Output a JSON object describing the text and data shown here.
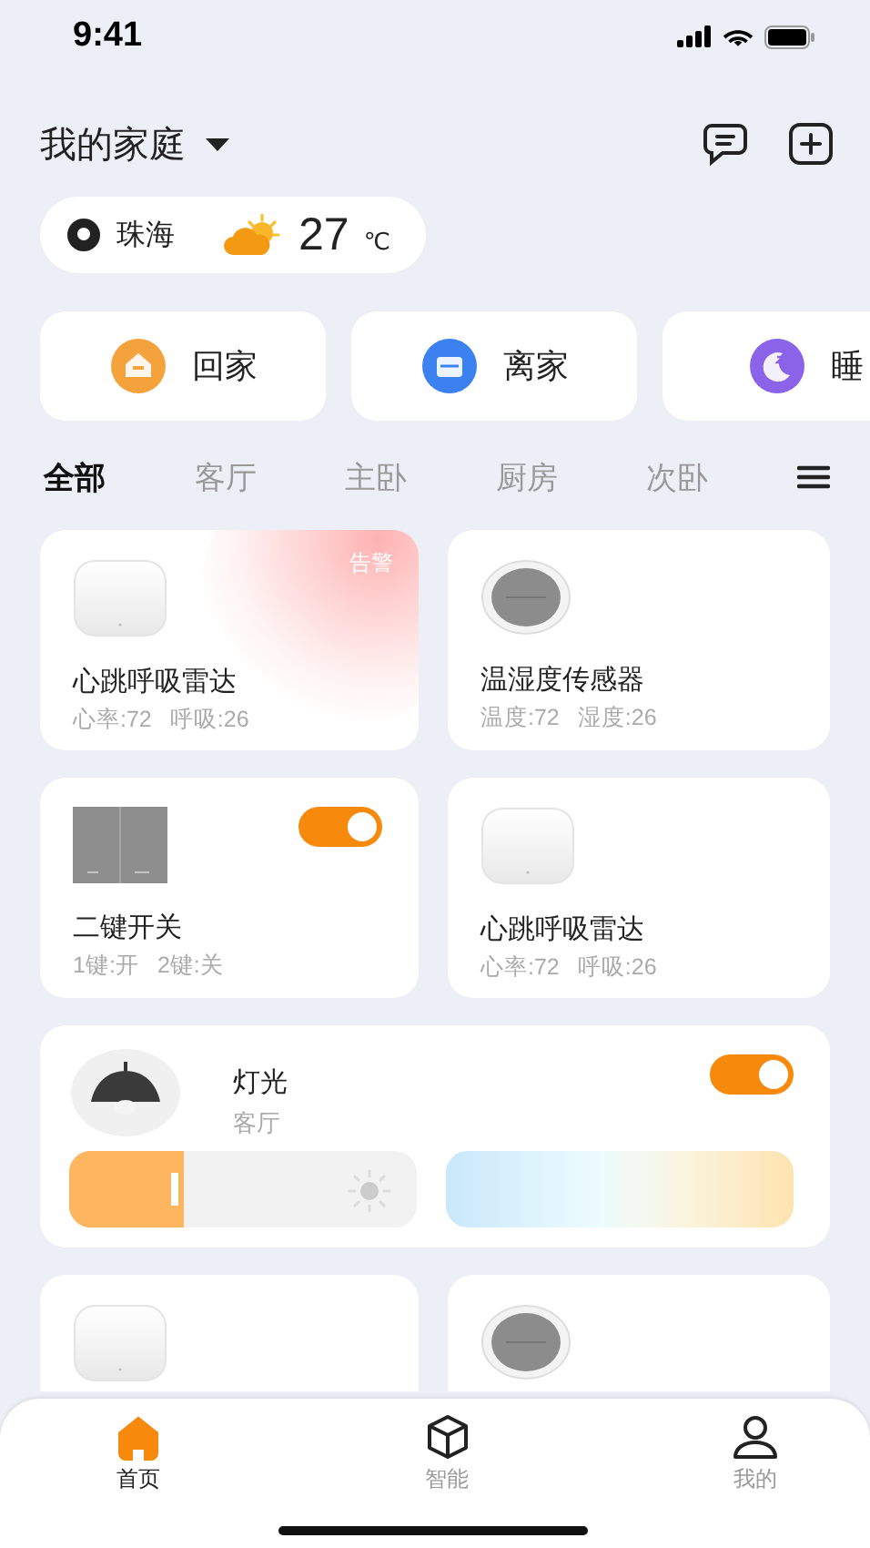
{
  "status_bar": {
    "time": "9:41"
  },
  "header": {
    "home": "我的家庭"
  },
  "weather": {
    "city": "珠海",
    "temperature": "27",
    "unit": "℃"
  },
  "scenes": [
    {
      "kind": "home",
      "label": "回家",
      "color": "#f4a23c"
    },
    {
      "kind": "away",
      "label": "离家",
      "color": "#3b82f0"
    },
    {
      "kind": "sleep",
      "label": "睡",
      "color": "#8a63e8"
    }
  ],
  "rooms": [
    {
      "label": "全部",
      "selected": true
    },
    {
      "label": "客厅",
      "selected": false
    },
    {
      "label": "主卧",
      "selected": false
    },
    {
      "label": "厨房",
      "selected": false
    },
    {
      "label": "次卧",
      "selected": false
    }
  ],
  "devices": [
    {
      "kind": "radar",
      "name": "心跳呼吸雷达",
      "stats": [
        "心率:72",
        "呼吸:26"
      ],
      "alert": "告警"
    },
    {
      "kind": "sensor",
      "name": "温湿度传感器",
      "stats": [
        "温度:72",
        "湿度:26"
      ]
    },
    {
      "kind": "switch",
      "name": "二键开关",
      "stats": [
        "1键:开",
        "2键:关"
      ],
      "on": true
    },
    {
      "kind": "radar",
      "name": "心跳呼吸雷达",
      "stats": [
        "心率:72",
        "呼吸:26"
      ]
    },
    {
      "kind": "light",
      "name": "灯光",
      "room": "客厅",
      "on": true,
      "level": 0.33
    },
    {
      "kind": "radar"
    },
    {
      "kind": "sensor"
    }
  ],
  "tab_bar": [
    {
      "kind": "home",
      "label": "首页",
      "selected": true
    },
    {
      "kind": "smart",
      "label": "智能",
      "selected": false
    },
    {
      "kind": "profile",
      "label": "我的",
      "selected": false
    }
  ]
}
